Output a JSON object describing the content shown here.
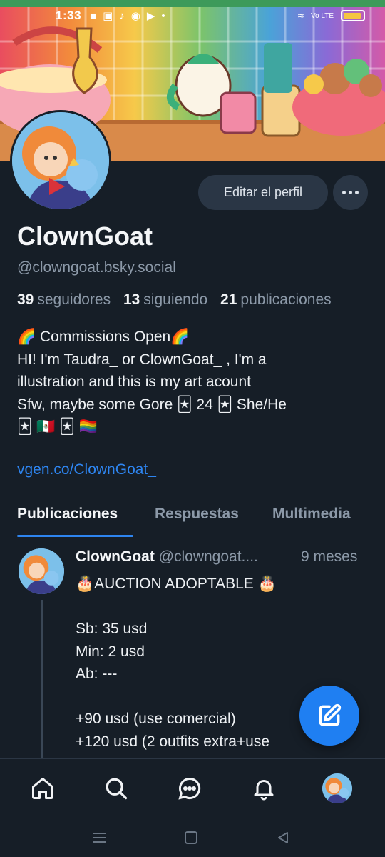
{
  "status_bar": {
    "time": "1:33",
    "network": "Vo LTE"
  },
  "profile": {
    "display_name": "ClownGoat",
    "handle": "@clowngoat.bsky.social",
    "edit_button_label": "Editar el perfil",
    "stats": {
      "followers_count": "39",
      "followers_label": "seguidores",
      "following_count": "13",
      "following_label": "siguiendo",
      "posts_count": "21",
      "posts_label": "publicaciones"
    },
    "bio": {
      "line1_text": " Commissions Open",
      "line2": "HI! I'm Taudra_ or ClownGoat_ , I'm a",
      "line3": "illustration and this is my art acount",
      "line4_text1": "Sfw, maybe some Gore ",
      "line4_text2": " 24 ",
      "line4_text3": " She/He"
    },
    "link": "vgen.co/ClownGoat_"
  },
  "tabs": [
    {
      "label": "Publicaciones",
      "active": true
    },
    {
      "label": "Respuestas",
      "active": false
    },
    {
      "label": "Multimedia",
      "active": false
    }
  ],
  "post": {
    "author": "ClownGoat",
    "handle": "@clowngoat....",
    "time": "9 meses",
    "title": "AUCTION ADOPTABLE ",
    "lines": [
      "",
      "Sb: 35 usd",
      "Min: 2 usd",
      "Ab: ---",
      "",
      "+90 usd (use comercial)",
      "+120 usd (2 outfits extra+use"
    ]
  },
  "bottom_nav": {
    "items": [
      "home-icon",
      "search-icon",
      "chat-icon",
      "bell-icon",
      "profile-avatar"
    ]
  },
  "colors": {
    "background": "#161e27",
    "accent": "#2e85f0",
    "muted_text": "#8c99a8",
    "button_bg": "#2a3645"
  }
}
